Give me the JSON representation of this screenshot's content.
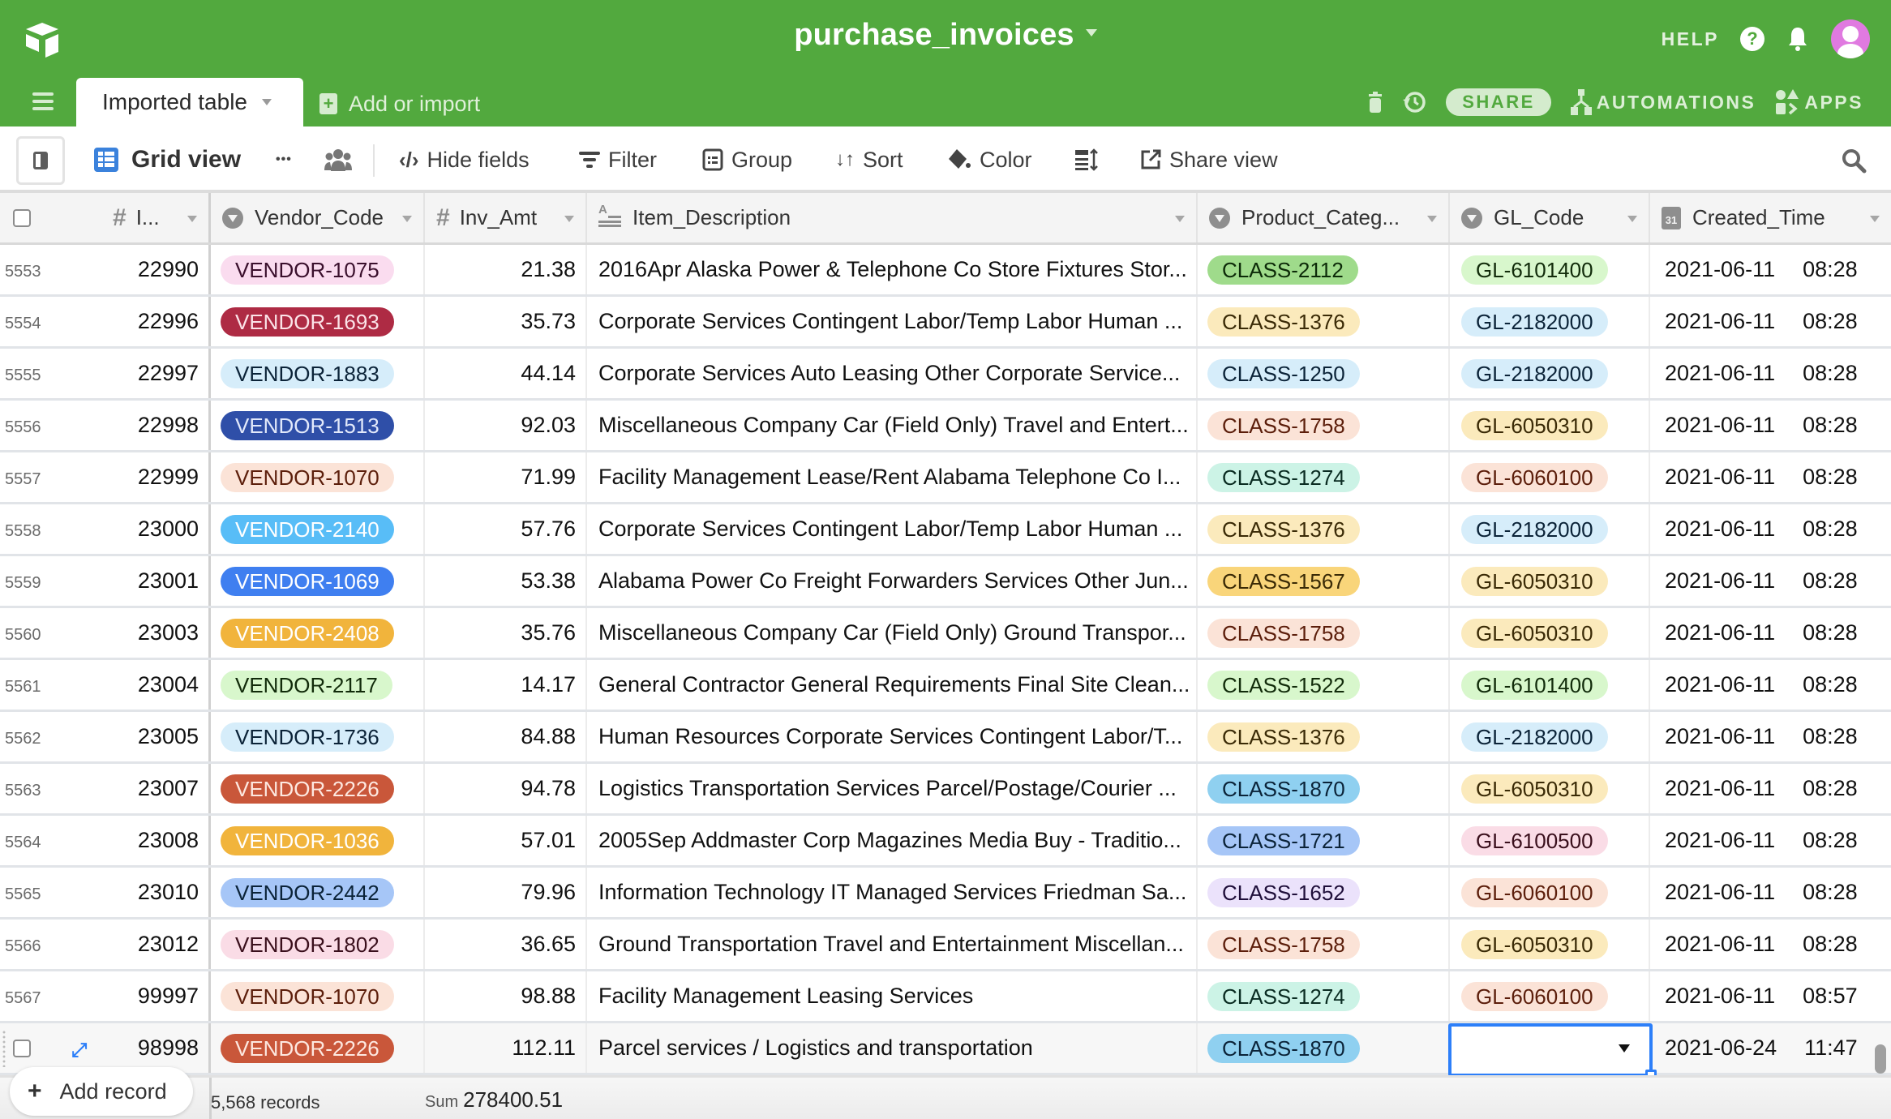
{
  "app": {
    "base_title": "purchase_invoices",
    "help_label": "HELP",
    "table_tab": "Imported table",
    "add_or_import": "Add or import",
    "actions": {
      "share": "SHARE",
      "automations": "AUTOMATIONS",
      "apps": "APPS"
    },
    "brand_color": "#52a93e"
  },
  "toolbar": {
    "view_name": "Grid view",
    "hide_fields": "Hide fields",
    "filter": "Filter",
    "group": "Group",
    "sort": "Sort",
    "color": "Color",
    "share_view": "Share view",
    "more": "•••"
  },
  "columns": [
    {
      "key": "id",
      "label": "I...",
      "icon": "number-icon"
    },
    {
      "key": "vendor",
      "label": "Vendor_Code",
      "icon": "single-select-icon"
    },
    {
      "key": "amt",
      "label": "Inv_Amt",
      "icon": "number-icon"
    },
    {
      "key": "desc",
      "label": "Item_Description",
      "icon": "long-text-icon"
    },
    {
      "key": "prod",
      "label": "Product_Categ...",
      "icon": "single-select-icon"
    },
    {
      "key": "gl",
      "label": "GL_Code",
      "icon": "single-select-icon"
    },
    {
      "key": "time",
      "label": "Created_Time",
      "icon": "created-time-icon"
    }
  ],
  "rows": [
    {
      "num": "5553",
      "id": "22990",
      "vendor": {
        "text": "VENDOR-1075",
        "bg": "#fadcef",
        "fg": "#3a0f2c"
      },
      "amt": "21.38",
      "desc": "2016Apr Alaska Power & Telephone Co Store Fixtures Stor...",
      "prod": {
        "text": "CLASS-2112",
        "bg": "#9fdb8b",
        "fg": "#0c2a08"
      },
      "gl": {
        "text": "GL-6101400",
        "bg": "#d8f7cc",
        "fg": "#112b0a"
      },
      "date": "2021-06-11",
      "time": "08:28"
    },
    {
      "num": "5554",
      "id": "22996",
      "vendor": {
        "text": "VENDOR-1693",
        "bg": "#ae2b44",
        "fg": "#fbe3e8"
      },
      "amt": "35.73",
      "desc": "Corporate Services Contingent Labor/Temp Labor Human ...",
      "prod": {
        "text": "CLASS-1376",
        "bg": "#fbeabc",
        "fg": "#3a2a06"
      },
      "gl": {
        "text": "GL-2182000",
        "bg": "#d6edfa",
        "fg": "#0b2338"
      },
      "date": "2021-06-11",
      "time": "08:28"
    },
    {
      "num": "5555",
      "id": "22997",
      "vendor": {
        "text": "VENDOR-1883",
        "bg": "#d6edfa",
        "fg": "#0b2338"
      },
      "amt": "44.14",
      "desc": "Corporate Services Auto Leasing Other Corporate Service...",
      "prod": {
        "text": "CLASS-1250",
        "bg": "#d6edfa",
        "fg": "#0b2338"
      },
      "gl": {
        "text": "GL-2182000",
        "bg": "#d6edfa",
        "fg": "#0b2338"
      },
      "date": "2021-06-11",
      "time": "08:28"
    },
    {
      "num": "5556",
      "id": "22998",
      "vendor": {
        "text": "VENDOR-1513",
        "bg": "#2f4fa8",
        "fg": "#e2e9fb"
      },
      "amt": "92.03",
      "desc": "Miscellaneous Company Car (Field Only) Travel and Entert...",
      "prod": {
        "text": "CLASS-1758",
        "bg": "#fbe3d7",
        "fg": "#5c1e0b"
      },
      "gl": {
        "text": "GL-6050310",
        "bg": "#fbeabc",
        "fg": "#3a2a06"
      },
      "date": "2021-06-11",
      "time": "08:28"
    },
    {
      "num": "5557",
      "id": "22999",
      "vendor": {
        "text": "VENDOR-1070",
        "bg": "#fbe3d7",
        "fg": "#5c1e0b"
      },
      "amt": "71.99",
      "desc": "Facility Management Lease/Rent Alabama Telephone Co I...",
      "prod": {
        "text": "CLASS-1274",
        "bg": "#ccf3e6",
        "fg": "#0a2c22"
      },
      "gl": {
        "text": "GL-6060100",
        "bg": "#fbe3d7",
        "fg": "#5c1e0b"
      },
      "date": "2021-06-11",
      "time": "08:28"
    },
    {
      "num": "5558",
      "id": "23000",
      "vendor": {
        "text": "VENDOR-2140",
        "bg": "#58bdf7",
        "fg": "#ffffff"
      },
      "amt": "57.76",
      "desc": "Corporate Services Contingent Labor/Temp Labor Human ...",
      "prod": {
        "text": "CLASS-1376",
        "bg": "#fbeabc",
        "fg": "#3a2a06"
      },
      "gl": {
        "text": "GL-2182000",
        "bg": "#d6edfa",
        "fg": "#0b2338"
      },
      "date": "2021-06-11",
      "time": "08:28"
    },
    {
      "num": "5559",
      "id": "23001",
      "vendor": {
        "text": "VENDOR-1069",
        "bg": "#3f7ff0",
        "fg": "#ffffff"
      },
      "amt": "53.38",
      "desc": "Alabama Power Co Freight Forwarders Services Other Jun...",
      "prod": {
        "text": "CLASS-1567",
        "bg": "#f9d57a",
        "fg": "#3a2a06"
      },
      "gl": {
        "text": "GL-6050310",
        "bg": "#fbeabc",
        "fg": "#3a2a06"
      },
      "date": "2021-06-11",
      "time": "08:28"
    },
    {
      "num": "5560",
      "id": "23003",
      "vendor": {
        "text": "VENDOR-2408",
        "bg": "#f1b43c",
        "fg": "#ffffff"
      },
      "amt": "35.76",
      "desc": "Miscellaneous Company Car (Field Only) Ground Transpor...",
      "prod": {
        "text": "CLASS-1758",
        "bg": "#fbe3d7",
        "fg": "#5c1e0b"
      },
      "gl": {
        "text": "GL-6050310",
        "bg": "#fbeabc",
        "fg": "#3a2a06"
      },
      "date": "2021-06-11",
      "time": "08:28"
    },
    {
      "num": "5561",
      "id": "23004",
      "vendor": {
        "text": "VENDOR-2117",
        "bg": "#d8f7cc",
        "fg": "#112b0a"
      },
      "amt": "14.17",
      "desc": "General Contractor General Requirements Final Site Clean...",
      "prod": {
        "text": "CLASS-1522",
        "bg": "#d8f7cc",
        "fg": "#112b0a"
      },
      "gl": {
        "text": "GL-6101400",
        "bg": "#d8f7cc",
        "fg": "#112b0a"
      },
      "date": "2021-06-11",
      "time": "08:28"
    },
    {
      "num": "5562",
      "id": "23005",
      "vendor": {
        "text": "VENDOR-1736",
        "bg": "#d6edfa",
        "fg": "#0b2338"
      },
      "amt": "84.88",
      "desc": "Human Resources Corporate Services Contingent Labor/T...",
      "prod": {
        "text": "CLASS-1376",
        "bg": "#fbeabc",
        "fg": "#3a2a06"
      },
      "gl": {
        "text": "GL-2182000",
        "bg": "#d6edfa",
        "fg": "#0b2338"
      },
      "date": "2021-06-11",
      "time": "08:28"
    },
    {
      "num": "5563",
      "id": "23007",
      "vendor": {
        "text": "VENDOR-2226",
        "bg": "#c9573a",
        "fg": "#fde8e0"
      },
      "amt": "94.78",
      "desc": "Logistics Transportation Services Parcel/Postage/Courier ...",
      "prod": {
        "text": "CLASS-1870",
        "bg": "#8fd0f0",
        "fg": "#0b2338"
      },
      "gl": {
        "text": "GL-6050310",
        "bg": "#fbeabc",
        "fg": "#3a2a06"
      },
      "date": "2021-06-11",
      "time": "08:28"
    },
    {
      "num": "5564",
      "id": "23008",
      "vendor": {
        "text": "VENDOR-1036",
        "bg": "#f1b43c",
        "fg": "#ffffff"
      },
      "amt": "57.01",
      "desc": "2005Sep Addmaster Corp Magazines Media Buy - Traditio...",
      "prod": {
        "text": "CLASS-1721",
        "bg": "#a6c6f7",
        "fg": "#0b2338"
      },
      "gl": {
        "text": "GL-6100500",
        "bg": "#fadce6",
        "fg": "#3a0f1c"
      },
      "date": "2021-06-11",
      "time": "08:28"
    },
    {
      "num": "5565",
      "id": "23010",
      "vendor": {
        "text": "VENDOR-2442",
        "bg": "#a6c6f7",
        "fg": "#0b2338"
      },
      "amt": "79.96",
      "desc": "Information Technology IT Managed Services Friedman Sa...",
      "prod": {
        "text": "CLASS-1652",
        "bg": "#ebe2fb",
        "fg": "#1f0f3a"
      },
      "gl": {
        "text": "GL-6060100",
        "bg": "#fbe3d7",
        "fg": "#5c1e0b"
      },
      "date": "2021-06-11",
      "time": "08:28"
    },
    {
      "num": "5566",
      "id": "23012",
      "vendor": {
        "text": "VENDOR-1802",
        "bg": "#fadce6",
        "fg": "#3a0f1c"
      },
      "amt": "36.65",
      "desc": "Ground Transportation Travel and Entertainment Miscellan...",
      "prod": {
        "text": "CLASS-1758",
        "bg": "#fbe3d7",
        "fg": "#5c1e0b"
      },
      "gl": {
        "text": "GL-6050310",
        "bg": "#fbeabc",
        "fg": "#3a2a06"
      },
      "date": "2021-06-11",
      "time": "08:28"
    },
    {
      "num": "5567",
      "id": "99997",
      "vendor": {
        "text": "VENDOR-1070",
        "bg": "#fbe3d7",
        "fg": "#5c1e0b"
      },
      "amt": "98.88",
      "desc": "Facility Management Leasing Services",
      "prod": {
        "text": "CLASS-1274",
        "bg": "#ccf3e6",
        "fg": "#0a2c22"
      },
      "gl": {
        "text": "GL-6060100",
        "bg": "#fbe3d7",
        "fg": "#5c1e0b"
      },
      "date": "2021-06-11",
      "time": "08:57"
    },
    {
      "num": "",
      "id": "98998",
      "vendor": {
        "text": "VENDOR-2226",
        "bg": "#c9573a",
        "fg": "#fde8e0"
      },
      "amt": "112.11",
      "desc": "Parcel services / Logistics and transportation",
      "prod": {
        "text": "CLASS-1870",
        "bg": "#8fd0f0",
        "fg": "#0b2338"
      },
      "gl": null,
      "date": "2021-06-24",
      "time": "11:47",
      "active": true
    }
  ],
  "footer": {
    "add_record": "Add record",
    "record_count": "5,568 records",
    "sum_label": "Sum",
    "sum_value": "278400.51"
  }
}
